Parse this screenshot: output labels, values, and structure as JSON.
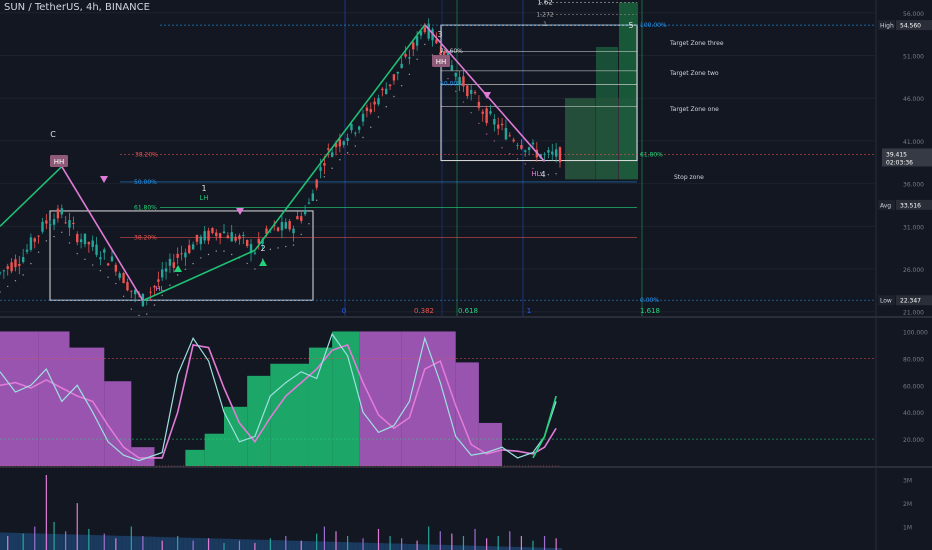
{
  "header": {
    "symbol_title": "SUN / TetherUS, 4h, BINANCE"
  },
  "price_axis": {
    "ticks": [
      "56.000",
      "51.000",
      "46.000",
      "41.000",
      "36.000",
      "31.000",
      "26.000",
      "21.000"
    ],
    "badges": {
      "high": {
        "label": "High",
        "value": "54.560"
      },
      "current": {
        "value": "39.415",
        "countdown": "02:03:36"
      },
      "avg": {
        "label": "Avg",
        "value": "33.516"
      },
      "low": {
        "label": "Low",
        "value": "22.347"
      }
    }
  },
  "osc_axis": {
    "ticks": [
      "100.000",
      "80.000",
      "60.000",
      "40.000",
      "20.000"
    ]
  },
  "vol_axis": {
    "ticks": [
      "3M",
      "2M",
      "1M"
    ]
  },
  "colors": {
    "bg": "#131722",
    "up": "#26a69a",
    "down": "#ef5350",
    "green": "#1fbf74",
    "pink": "#e07bd8",
    "purple": "#b05fc7",
    "teal": "#7fd6d6",
    "cyan": "#2196f3",
    "fib_green": "#22d37a",
    "target_bar": "#1b5e3c",
    "stop": "#5a3a4a"
  },
  "chart_data": [
    {
      "type": "candlestick",
      "title": "SUN / TetherUS, 4h, BINANCE",
      "ylim": [
        20.5,
        57.5
      ],
      "x": [
        0,
        145
      ],
      "price_path": [
        [
          0,
          25.5
        ],
        [
          6,
          27.5
        ],
        [
          12,
          31.5
        ],
        [
          16,
          32.5
        ],
        [
          20,
          30
        ],
        [
          26,
          28
        ],
        [
          30,
          26.5
        ],
        [
          34,
          23.5
        ],
        [
          37,
          22.4
        ],
        [
          41,
          24.5
        ],
        [
          46,
          27.5
        ],
        [
          52,
          29.5
        ],
        [
          57,
          30.5
        ],
        [
          62,
          29.5
        ],
        [
          66,
          28.2
        ],
        [
          70,
          30.5
        ],
        [
          76,
          31
        ],
        [
          80,
          33.5
        ],
        [
          84,
          39
        ],
        [
          88,
          41
        ],
        [
          93,
          43
        ],
        [
          98,
          46
        ],
        [
          103,
          49
        ],
        [
          106,
          51
        ],
        [
          110,
          54.5
        ],
        [
          114,
          52
        ],
        [
          118,
          49
        ],
        [
          122,
          46.5
        ],
        [
          126,
          44
        ],
        [
          131,
          42
        ],
        [
          136,
          40.5
        ],
        [
          141,
          39.2
        ],
        [
          145,
          39.4
        ]
      ],
      "series": [
        {
          "name": "zigzag",
          "points": [
            {
              "x": 0,
              "y": 31.0
            },
            {
              "x": 16,
              "y": 38.0
            },
            {
              "x": 37,
              "y": 22.3
            },
            {
              "x": 66,
              "y": 28.2
            },
            {
              "x": 110,
              "y": 54.6
            },
            {
              "x": 141,
              "y": 38.6
            }
          ]
        }
      ],
      "annotations": {
        "wave_labels": [
          "C",
          "1",
          "2",
          "3",
          "4",
          "5"
        ],
        "pivots": [
          "HH",
          "LH",
          "HL",
          "HH",
          "HL"
        ],
        "levels_left": [
          "78.60%",
          "61.80%",
          "50.00%",
          "38.20%"
        ],
        "levels_right": [
          "100.00%",
          "61.80%",
          "0.00%"
        ],
        "fib_top": [
          "1.62",
          "1.272",
          "1"
        ],
        "fib_time": [
          "0",
          "0.382",
          "0.618",
          "1",
          "1.618"
        ],
        "targets": [
          "Target Zone three",
          "Target Zone two",
          "Target Zone one"
        ],
        "stop": "Stop zone"
      }
    },
    {
      "type": "bar",
      "name_panel": "oscillator",
      "ylim": [
        0,
        110
      ],
      "x": [
        0,
        145
      ],
      "histogram": [
        {
          "x0": 0,
          "x1": 10,
          "v": 100,
          "c": "purple"
        },
        {
          "x0": 10,
          "x1": 18,
          "v": 100,
          "c": "purple"
        },
        {
          "x0": 18,
          "x1": 27,
          "v": 88,
          "c": "purple"
        },
        {
          "x0": 27,
          "x1": 34,
          "v": 63,
          "c": "purple"
        },
        {
          "x0": 34,
          "x1": 40,
          "v": 14,
          "c": "purple"
        },
        {
          "x0": 48,
          "x1": 53,
          "v": 12,
          "c": "green"
        },
        {
          "x0": 53,
          "x1": 58,
          "v": 24,
          "c": "green"
        },
        {
          "x0": 58,
          "x1": 64,
          "v": 44,
          "c": "green"
        },
        {
          "x0": 64,
          "x1": 70,
          "v": 67,
          "c": "green"
        },
        {
          "x0": 70,
          "x1": 80,
          "v": 76,
          "c": "green"
        },
        {
          "x0": 80,
          "x1": 86,
          "v": 88,
          "c": "green"
        },
        {
          "x0": 86,
          "x1": 93,
          "v": 100,
          "c": "green"
        },
        {
          "x0": 93,
          "x1": 104,
          "v": 100,
          "c": "purple"
        },
        {
          "x0": 104,
          "x1": 118,
          "v": 100,
          "c": "purple"
        },
        {
          "x0": 118,
          "x1": 124,
          "v": 77,
          "c": "purple"
        },
        {
          "x0": 124,
          "x1": 130,
          "v": 32,
          "c": "purple"
        }
      ],
      "series": [
        {
          "name": "k",
          "values": [
            [
              0,
              70
            ],
            [
              4,
              55
            ],
            [
              8,
              60
            ],
            [
              12,
              72
            ],
            [
              16,
              48
            ],
            [
              20,
              60
            ],
            [
              24,
              40
            ],
            [
              28,
              18
            ],
            [
              32,
              8
            ],
            [
              36,
              4
            ],
            [
              42,
              10
            ],
            [
              46,
              68
            ],
            [
              50,
              95
            ],
            [
              54,
              78
            ],
            [
              58,
              40
            ],
            [
              62,
              18
            ],
            [
              66,
              22
            ],
            [
              70,
              52
            ],
            [
              74,
              62
            ],
            [
              78,
              70
            ],
            [
              82,
              65
            ],
            [
              86,
              98
            ],
            [
              90,
              82
            ],
            [
              94,
              40
            ],
            [
              98,
              25
            ],
            [
              102,
              30
            ],
            [
              106,
              48
            ],
            [
              110,
              95
            ],
            [
              114,
              62
            ],
            [
              118,
              22
            ],
            [
              122,
              8
            ],
            [
              126,
              10
            ],
            [
              130,
              14
            ],
            [
              134,
              6
            ],
            [
              138,
              10
            ],
            [
              141,
              22
            ],
            [
              144,
              48
            ]
          ]
        },
        {
          "name": "d",
          "values": [
            [
              0,
              60
            ],
            [
              4,
              62
            ],
            [
              8,
              58
            ],
            [
              12,
              64
            ],
            [
              16,
              58
            ],
            [
              20,
              52
            ],
            [
              24,
              48
            ],
            [
              28,
              30
            ],
            [
              32,
              14
            ],
            [
              36,
              6
            ],
            [
              42,
              6
            ],
            [
              46,
              40
            ],
            [
              50,
              90
            ],
            [
              54,
              88
            ],
            [
              58,
              58
            ],
            [
              62,
              32
            ],
            [
              66,
              18
            ],
            [
              70,
              36
            ],
            [
              74,
              52
            ],
            [
              78,
              62
            ],
            [
              82,
              72
            ],
            [
              86,
              86
            ],
            [
              90,
              90
            ],
            [
              94,
              62
            ],
            [
              98,
              38
            ],
            [
              102,
              28
            ],
            [
              106,
              36
            ],
            [
              110,
              72
            ],
            [
              114,
              78
            ],
            [
              118,
              45
            ],
            [
              122,
              16
            ],
            [
              126,
              9
            ],
            [
              130,
              12
            ],
            [
              134,
              11
            ],
            [
              138,
              9
            ],
            [
              141,
              14
            ],
            [
              144,
              28
            ]
          ]
        }
      ]
    },
    {
      "type": "bar",
      "name_panel": "volume",
      "ylim": [
        0,
        3500000
      ],
      "x": [
        0,
        145
      ],
      "spikes": [
        [
          2,
          0.6
        ],
        [
          6,
          0.7
        ],
        [
          9,
          1.0
        ],
        [
          12,
          3.2
        ],
        [
          14,
          1.2
        ],
        [
          17,
          0.8
        ],
        [
          20,
          2.0
        ],
        [
          23,
          0.9
        ],
        [
          27,
          0.7
        ],
        [
          30,
          0.5
        ],
        [
          34,
          1.0
        ],
        [
          37,
          0.6
        ],
        [
          42,
          0.4
        ],
        [
          46,
          0.6
        ],
        [
          50,
          0.4
        ],
        [
          54,
          0.5
        ],
        [
          58,
          0.3
        ],
        [
          62,
          0.4
        ],
        [
          66,
          0.3
        ],
        [
          70,
          0.5
        ],
        [
          74,
          0.6
        ],
        [
          78,
          0.4
        ],
        [
          82,
          0.7
        ],
        [
          84,
          1.0
        ],
        [
          87,
          0.8
        ],
        [
          90,
          0.6
        ],
        [
          94,
          0.5
        ],
        [
          98,
          0.9
        ],
        [
          101,
          0.6
        ],
        [
          104,
          0.5
        ],
        [
          108,
          0.4
        ],
        [
          111,
          1.0
        ],
        [
          114,
          0.8
        ],
        [
          117,
          0.7
        ],
        [
          120,
          0.6
        ],
        [
          123,
          0.9
        ],
        [
          126,
          0.5
        ],
        [
          129,
          0.6
        ],
        [
          132,
          0.8
        ],
        [
          135,
          0.6
        ],
        [
          138,
          0.4
        ],
        [
          141,
          0.6
        ],
        [
          144,
          0.5
        ]
      ],
      "ma_range": [
        0.75,
        0.08
      ]
    }
  ]
}
